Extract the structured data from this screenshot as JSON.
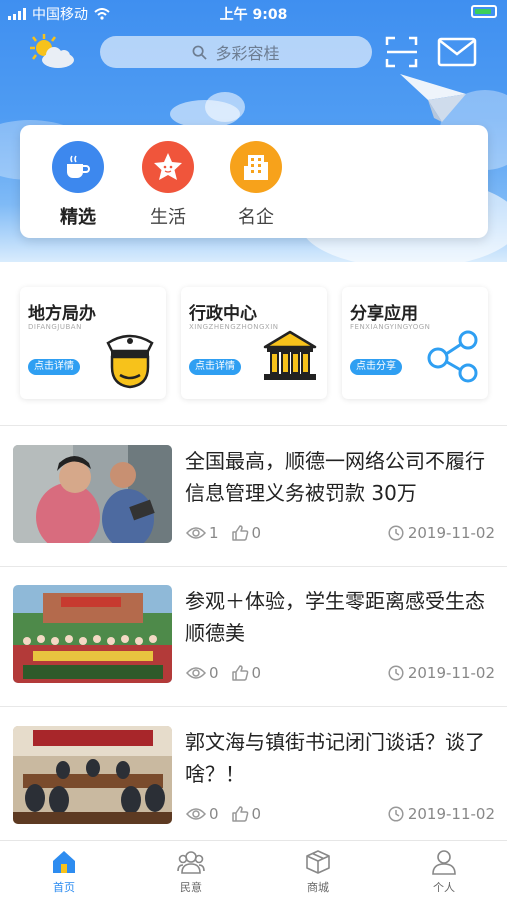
{
  "status_bar": {
    "carrier": "中国移动",
    "time": "上午 9:08"
  },
  "search": {
    "placeholder": "多彩容桂"
  },
  "categories": [
    {
      "label": "精选",
      "icon": "coffee-icon",
      "color": "#3d88ee",
      "active": true
    },
    {
      "label": "生活",
      "icon": "star-face-icon",
      "color": "#f0553b"
    },
    {
      "label": "名企",
      "icon": "building-icon",
      "color": "#f7a21b"
    }
  ],
  "services": [
    {
      "title": "地方局办",
      "subtitle": "DIFANGJUBAN",
      "button": "点击详情",
      "icon": "police-officer-icon"
    },
    {
      "title": "行政中心",
      "subtitle": "XINGZHENGZHONGXIN",
      "button": "点击详情",
      "icon": "government-building-icon"
    },
    {
      "title": "分享应用",
      "subtitle": "FENXIANGYINGYOGN",
      "button": "点击分享",
      "icon": "share-icon"
    }
  ],
  "news": [
    {
      "title": "全国最高，顺德一网络公司不履行信息管理义务被罚款 30万",
      "views": "1",
      "likes": "0",
      "date": "2019-11-02",
      "image": "people-with-phone-photo"
    },
    {
      "title": "参观＋体验，学生零距离感受生态顺德美",
      "views": "0",
      "likes": "0",
      "date": "2019-11-02",
      "image": "students-group-photo"
    },
    {
      "title": "郭文海与镇街书记闭门谈话？谈了啥？！",
      "views": "0",
      "likes": "0",
      "date": "2019-11-02",
      "image": "meeting-room-photo"
    }
  ],
  "tabs": [
    {
      "label": "首页",
      "icon": "home-icon",
      "active": true
    },
    {
      "label": "民意",
      "icon": "people-icon"
    },
    {
      "label": "商城",
      "icon": "box-icon"
    },
    {
      "label": "个人",
      "icon": "person-icon"
    }
  ],
  "colors": {
    "primary": "#2d8cf0",
    "header": "#3f8ff0",
    "button": "#2f9ff2"
  }
}
